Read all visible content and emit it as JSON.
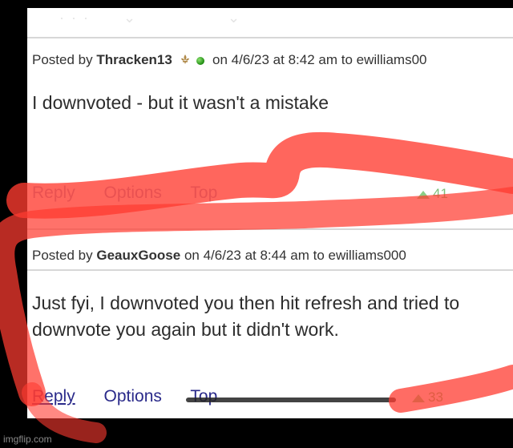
{
  "posts": [
    {
      "meta_prefix": "Posted by",
      "username": "Thracken13",
      "meta_suffix": "on 4/6/23 at 8:42 am to ewilliams00",
      "body": "I downvoted - but it wasn't a mistake",
      "actions": {
        "reply": "Reply",
        "options": "Options",
        "top": "Top"
      },
      "votes": "41"
    },
    {
      "meta_prefix": "Posted by",
      "username": "GeauxGoose",
      "meta_suffix": "on 4/6/23 at 8:44 am to ewilliams000",
      "body": "Just fyi, I downvoted you then hit refresh and tried to downvote you again but it didn't work.",
      "actions": {
        "reply": "Reply",
        "options": "Options",
        "top": "Top"
      },
      "votes": "33"
    }
  ],
  "watermark": "imgflip.com",
  "colors": {
    "background": "#000000",
    "panel": "#ffffff",
    "link": "#2a2a8a",
    "highlight": "#ff3b30",
    "upvote": "#8ccf86"
  }
}
